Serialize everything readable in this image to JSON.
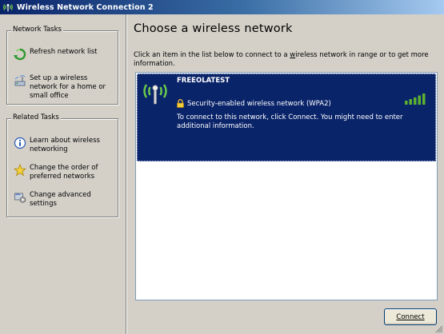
{
  "window": {
    "title": "Wireless Network Connection 2"
  },
  "network_tasks": {
    "heading": "Network Tasks",
    "items": [
      {
        "label": "Refresh network list",
        "icon": "refresh-icon"
      },
      {
        "label": "Set up a wireless network for a home or small office",
        "icon": "setup-network-icon"
      }
    ]
  },
  "related_tasks": {
    "heading": "Related Tasks",
    "items": [
      {
        "label": "Learn about wireless networking",
        "icon": "info-icon"
      },
      {
        "label": "Change the order of preferred networks",
        "icon": "star-icon"
      },
      {
        "label": "Change advanced settings",
        "icon": "settings-icon"
      }
    ]
  },
  "main": {
    "title": "Choose a wireless network",
    "instructions_before": "Click an item in the list below to connect to a ",
    "instructions_underlined": "w",
    "instructions_after": "ireless network in range or to get more information."
  },
  "networks": [
    {
      "ssid": "FREEOLATEST",
      "security": "Security-enabled wireless network (WPA2)",
      "description": "To connect to this network, click Connect. You might need to enter additional information.",
      "signal_bars": 5,
      "signal_bars_max": 5,
      "selected": true
    }
  ],
  "buttons": {
    "connect": "Connect"
  },
  "colors": {
    "title_bar": "#0a246a",
    "selection": "#0a246a",
    "signal": "#5cb030"
  }
}
